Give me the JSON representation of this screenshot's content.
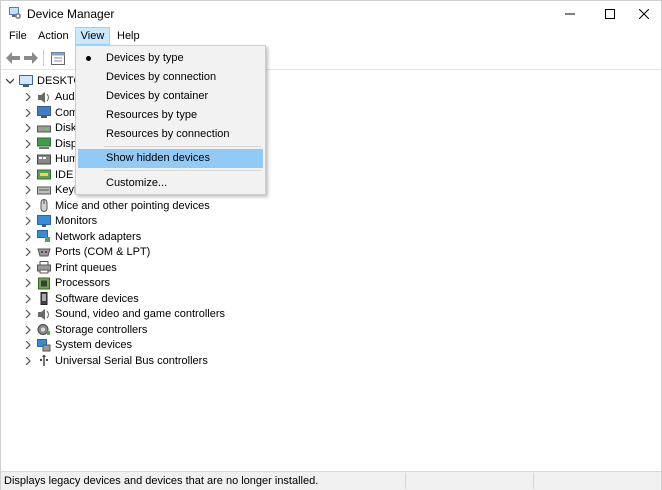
{
  "window": {
    "title": "Device Manager"
  },
  "menu": {
    "file": "File",
    "action": "Action",
    "view": "View",
    "help": "Help"
  },
  "tree": {
    "root_label": "DESKTO",
    "items": [
      {
        "label": "Aud",
        "icon": "audio-icon"
      },
      {
        "label": "Com",
        "icon": "computer-icon"
      },
      {
        "label": "Disk",
        "icon": "disk-drive-icon"
      },
      {
        "label": "Disp",
        "icon": "display-adapter-icon"
      },
      {
        "label": "Hum",
        "icon": "hid-icon"
      },
      {
        "label": "IDE A",
        "icon": "ide-icon"
      },
      {
        "label": "Keyb",
        "icon": "keyboard-icon"
      },
      {
        "label": "Mice and other pointing devices",
        "icon": "mouse-icon"
      },
      {
        "label": "Monitors",
        "icon": "monitor-icon"
      },
      {
        "label": "Network adapters",
        "icon": "network-icon"
      },
      {
        "label": "Ports (COM & LPT)",
        "icon": "port-icon"
      },
      {
        "label": "Print queues",
        "icon": "printer-icon"
      },
      {
        "label": "Processors",
        "icon": "processor-icon"
      },
      {
        "label": "Software devices",
        "icon": "software-device-icon"
      },
      {
        "label": "Sound, video and game controllers",
        "icon": "sound-icon"
      },
      {
        "label": "Storage controllers",
        "icon": "storage-controller-icon"
      },
      {
        "label": "System devices",
        "icon": "system-device-icon"
      },
      {
        "label": "Universal Serial Bus controllers",
        "icon": "usb-icon"
      }
    ]
  },
  "view_menu": {
    "items": [
      "Devices by type",
      "Devices by connection",
      "Devices by container",
      "Resources by type",
      "Resources by connection",
      "Show hidden devices",
      "Customize..."
    ],
    "checked_index": 0,
    "highlighted_index": 5
  },
  "status": {
    "text": "Displays legacy devices and devices that are no longer installed."
  },
  "colors": {
    "menu_highlight": "#91c9f7",
    "menu_active": "#cce8ff"
  }
}
